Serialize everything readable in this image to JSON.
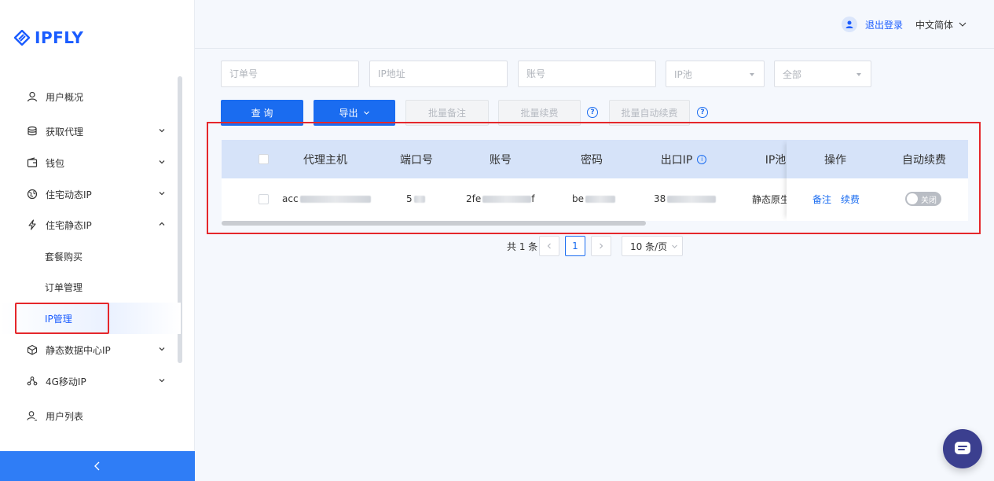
{
  "brand": {
    "name": "IPFLY",
    "color": "#1a5cff"
  },
  "header": {
    "logout": "退出登录",
    "language": "中文简体"
  },
  "sidebar": {
    "items": [
      {
        "label": "用户概况",
        "icon": "user-icon"
      },
      {
        "label": "获取代理",
        "icon": "database-icon"
      },
      {
        "label": "钱包",
        "icon": "wallet-icon"
      },
      {
        "label": "住宅动态IP",
        "icon": "globe-icon"
      },
      {
        "label": "住宅静态IP",
        "icon": "lightning-icon"
      },
      {
        "label": "静态数据中心IP",
        "icon": "cube-icon"
      },
      {
        "label": "4G移动IP",
        "icon": "network-icon"
      },
      {
        "label": "用户列表",
        "icon": "user-list-icon"
      }
    ],
    "sub_items": [
      {
        "label": "套餐购买"
      },
      {
        "label": "订单管理"
      },
      {
        "label": "IP管理",
        "active": true
      }
    ],
    "collapse_icon": "chevron-left-icon"
  },
  "filters": {
    "order_no": "订单号",
    "ip_address": "IP地址",
    "account": "账号",
    "ip_pool": "IP池",
    "status": "全部"
  },
  "actions": {
    "query": "查 询",
    "export": "导出",
    "batch_note": "批量备注",
    "batch_renew": "批量续费",
    "batch_auto_renew": "批量自动续费"
  },
  "table": {
    "columns": [
      "代理主机",
      "端口号",
      "账号",
      "密码",
      "出口IP",
      "IP池",
      "操作",
      "自动续费"
    ],
    "rows": [
      {
        "host": "acc",
        "port": "5",
        "account": "2fe",
        "account_tail": "f",
        "password": "be",
        "exit_ip": "38",
        "pool": "静态原生",
        "op_note": "备注",
        "op_renew": "续费",
        "auto_renew": "关闭"
      }
    ]
  },
  "pagination": {
    "total": "共 1 条",
    "current": "1",
    "page_size": "10 条/页"
  },
  "colors": {
    "primary": "#1a6cf0",
    "header_row": "#d6e3f9",
    "highlight": "#e5272b"
  }
}
